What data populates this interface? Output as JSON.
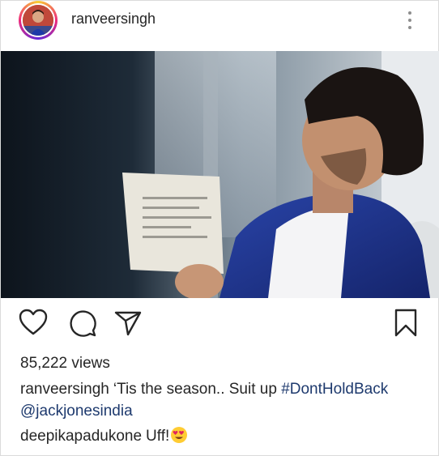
{
  "header": {
    "username": "ranveersingh"
  },
  "post": {
    "views": "85,222 views",
    "caption": {
      "username": "ranveersingh",
      "text": "‘Tis the season.. Suit up ",
      "hashtag": "#DontHoldBack",
      "mention": "@jackjonesindia"
    },
    "comment": {
      "username": "deepikapadukone",
      "text": "Uff!",
      "emoji": "heart-eyes-emoji"
    }
  },
  "icons": {
    "like": "heart-icon",
    "comment": "comment-bubble-icon",
    "share": "paper-plane-icon",
    "save": "bookmark-icon",
    "more": "vertical-dots-icon"
  },
  "colors": {
    "text": "#262626",
    "tag": "#1e3a6e",
    "story_ring": "#ee2a7b"
  }
}
